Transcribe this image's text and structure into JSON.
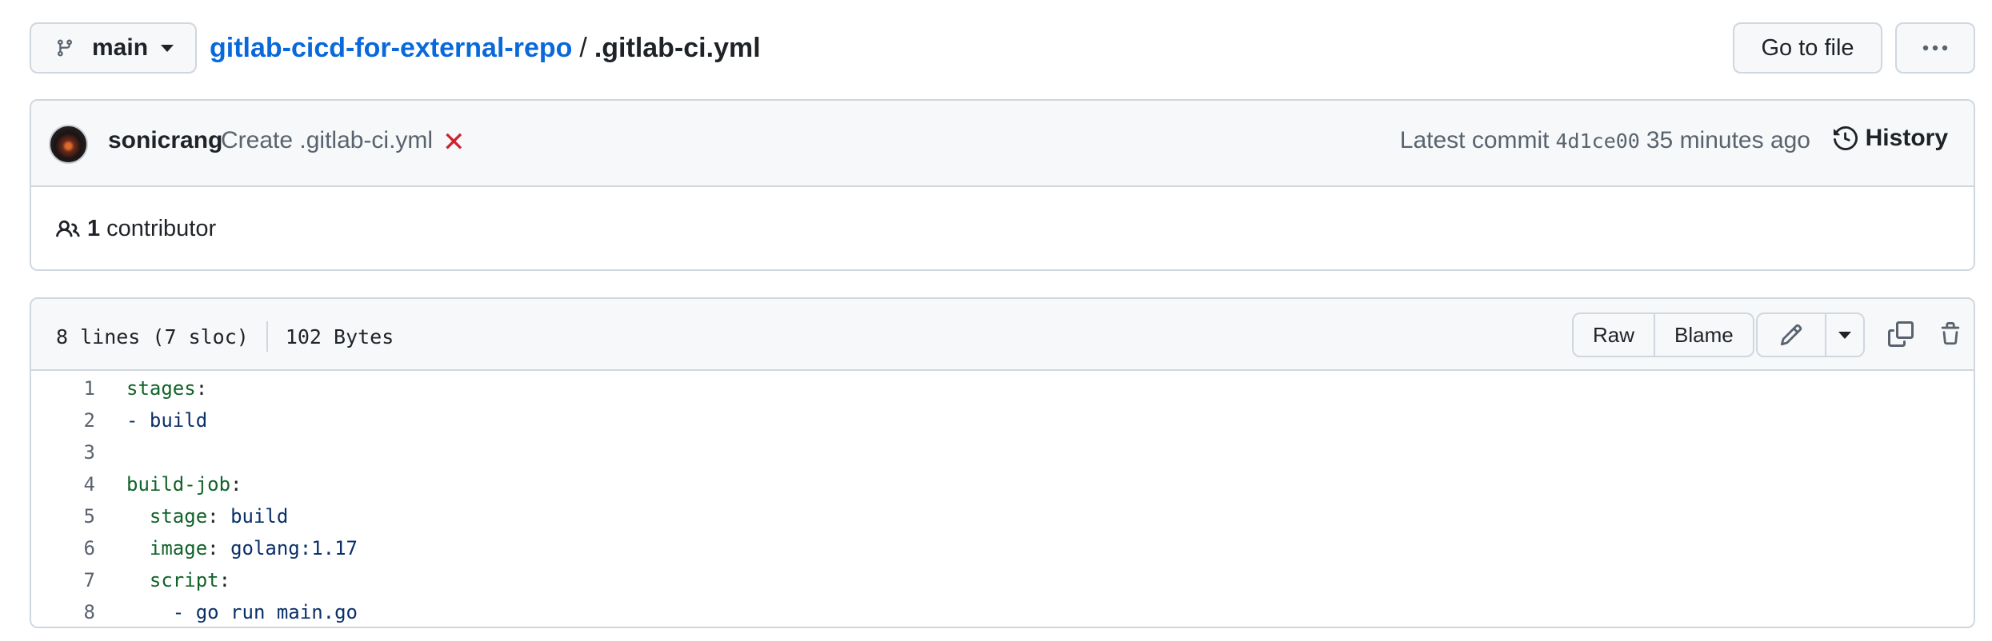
{
  "branch": {
    "name": "main"
  },
  "breadcrumb": {
    "repo": "gitlab-cicd-for-external-repo",
    "separator": "/",
    "file": ".gitlab-ci.yml"
  },
  "toolbar": {
    "go_to_file": "Go to file",
    "more_icon": "kebab-horizontal-icon"
  },
  "commit": {
    "author": "sonicrang",
    "message": "Create .gitlab-ci.yml",
    "status": "failed",
    "status_glyph": "✕",
    "latest_label": "Latest commit",
    "sha": "4d1ce00",
    "time": "35 minutes ago",
    "history_label": "History",
    "contributors_count": "1",
    "contributors_label": "contributor"
  },
  "file": {
    "lines_info": "8 lines (7 sloc)",
    "size": "102 Bytes",
    "raw_label": "Raw",
    "blame_label": "Blame",
    "code": [
      {
        "num": "1",
        "key": "stages",
        "colon": ":",
        "val": "",
        "indent": ""
      },
      {
        "num": "2",
        "key": "",
        "colon": "",
        "val": "- build",
        "indent": ""
      },
      {
        "num": "3",
        "key": "",
        "colon": "",
        "val": "",
        "indent": ""
      },
      {
        "num": "4",
        "key": "build-job",
        "colon": ":",
        "val": "",
        "indent": ""
      },
      {
        "num": "5",
        "key": "stage",
        "colon": ": ",
        "val": "build",
        "indent": "  "
      },
      {
        "num": "6",
        "key": "image",
        "colon": ": ",
        "val": "golang:1.17",
        "indent": "  "
      },
      {
        "num": "7",
        "key": "script",
        "colon": ":",
        "val": "",
        "indent": "  "
      },
      {
        "num": "8",
        "key": "",
        "colon": "",
        "val": "- go run main.go",
        "indent": "    "
      }
    ]
  },
  "colors": {
    "link": "#0969da",
    "border": "#d0d7de",
    "header_bg": "#f6f8fa",
    "fail": "#cf222e",
    "yaml_key": "#116329",
    "yaml_value": "#0a3069"
  }
}
